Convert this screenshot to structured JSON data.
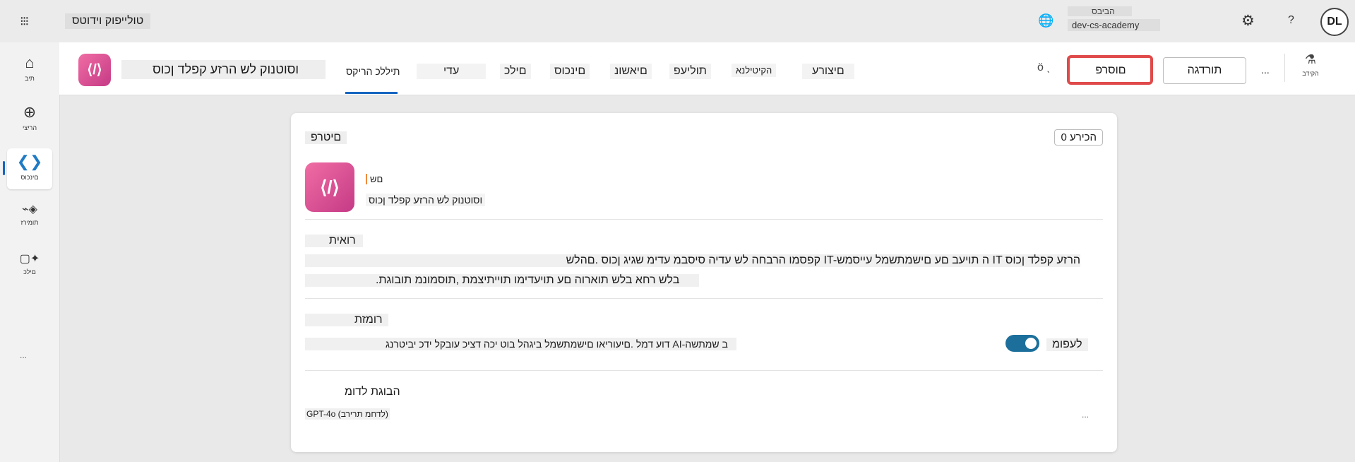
{
  "topbar": {
    "apps_icon": "waffle-icon",
    "app_title": "טולייפוק וידוטס",
    "environment_label": "הביבס",
    "environment_value": "dev-cs-academy",
    "environment_icon": "globe-icon",
    "settings_icon": "gear-icon",
    "help_label": "?",
    "avatar_initials": "DL"
  },
  "leftnav": {
    "items": [
      {
        "label": "תיב",
        "icon": "home-icon"
      },
      {
        "label": "הריצי",
        "icon": "add-icon"
      },
      {
        "label": "םינכוס",
        "icon": "agents-icon"
      },
      {
        "label": "תומירז",
        "icon": "flows-icon"
      },
      {
        "label": "םילכ",
        "icon": "tools-icon"
      }
    ],
    "more_label": "..."
  },
  "commandbar": {
    "agent_name": "וסוטנוק לש הרזע קפלד ןכוס",
    "tabs": [
      "תיללכ הריקס",
      "עדי",
      "םילכ",
      "םינכוס",
      "םיאשונ",
      "תוליעפ",
      "הקיטילנא",
      "םיצורע"
    ],
    "extra_label": "ö ˎ",
    "publish_label": "םוסרפ",
    "settings_label": "תורדגה",
    "more_label": "...",
    "test_label": "הקידב",
    "test_icon": "flask-icon"
  },
  "card": {
    "title": "םיטרפ",
    "edit_label": "הכירע 0",
    "name_label": "םש",
    "name_value": "וסוטנוק לש הרזע קפלד ןכוס",
    "description_title": "רואית",
    "description_line1": "קפסמו הרבחה לש עדיה סיסבמ עדימ שגיג ןכוס .םהלש IT-ה תויעב םע םישמתשמל עייסמש IT הרזע קפלד ןכוס",
    "description_line2": ".בלש רחא בלש תוארוה םע תויעדימו תוייתיצמת ,תוסמונמ תובוגת",
    "instructions_title": "רומזת",
    "instructions_text": "דוע דמל .םיעוריאו םישמתשמל ביגהל בוט יכה דציכ עובקל ידכ יביטרנג AI-ב שמתשה",
    "toggle_label": "לעפומ",
    "toggle_on": true,
    "model_title": "הבוגת לדומ",
    "model_value": "GPT-4o (לדחמ תרירב)",
    "model_more": "..."
  }
}
